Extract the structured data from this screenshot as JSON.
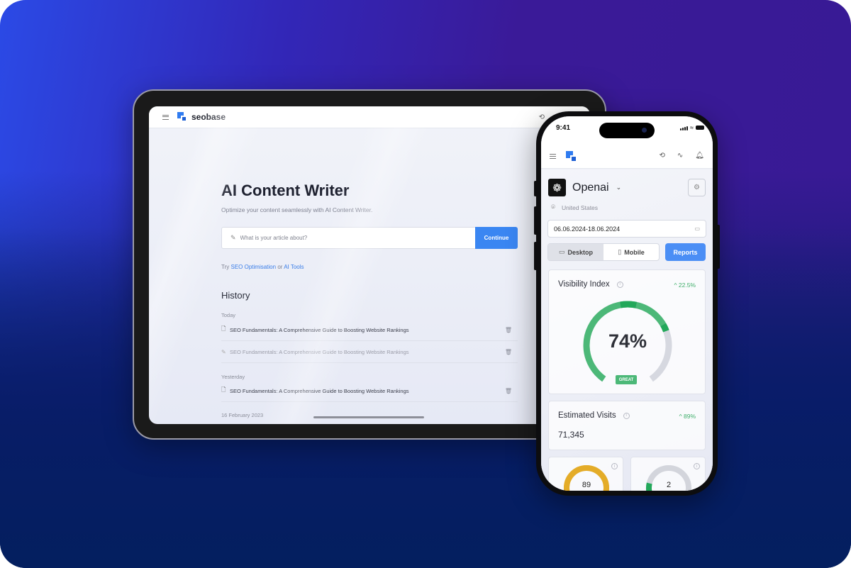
{
  "tablet": {
    "brand": "seobase",
    "title": "AI Content Writer",
    "subtitle": "Optimize your content seamlessly with AI Content Writer.",
    "input_placeholder": "What is your article about?",
    "continue_label": "Continue",
    "try_prefix": "Try",
    "try_link_1": "SEO Optimisation",
    "try_or": "or",
    "try_link_2": "AI Tools",
    "history_title": "History",
    "groups": [
      {
        "label": "Today",
        "items": [
          {
            "title": "SEO Fundamentals: A Comprehensive Guide to Boosting Website Rankings",
            "icon": "document-icon",
            "muted": false
          },
          {
            "title": "SEO Fundamentals: A Comprehensive Guide to Boosting Website Rankings",
            "icon": "pencil-icon",
            "muted": true
          }
        ]
      },
      {
        "label": "Yesterday",
        "items": [
          {
            "title": "SEO Fundamentals: A Comprehensive Guide to Boosting Website Rankings",
            "icon": "document-icon",
            "muted": false
          }
        ]
      },
      {
        "label": "16 February 2023",
        "items": []
      }
    ]
  },
  "phone": {
    "time": "9:41",
    "org_name": "Openai",
    "location": "United States",
    "date_range": "06.06.2024-18.06.2024",
    "segments": [
      {
        "label": "Desktop",
        "icon": "monitor-icon",
        "active": true
      },
      {
        "label": "Mobile",
        "icon": "smartphone-icon",
        "active": false
      }
    ],
    "reports_label": "Reports",
    "visibility": {
      "title": "Visibility Index",
      "delta": "22.5%",
      "value_percent": 74,
      "value_label": "74%",
      "badge": "GREAT"
    },
    "estimated_visits": {
      "title": "Estimated Visits",
      "delta": "89%",
      "value": "71,345"
    },
    "mini_cards": [
      {
        "value": "89",
        "fraction": 0.89,
        "color": "#e4ac28",
        "track": "#e8c36a"
      },
      {
        "value": "2",
        "fraction": 0.12,
        "color": "#22a85a",
        "track": "#d3d5dc"
      }
    ],
    "colors": {
      "accent": "#4b8ef5",
      "positive": "#3fae6a",
      "gauge_green": "#4cb878",
      "gauge_green_dark": "#22a85a",
      "gauge_track": "#d6d8e0"
    }
  }
}
